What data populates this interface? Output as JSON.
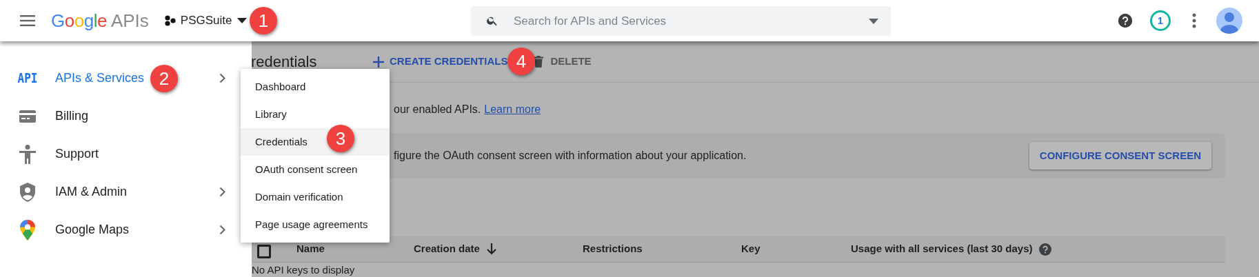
{
  "header": {
    "logo": "Google",
    "logo_suffix": "APIs",
    "project": "PSGSuite",
    "search": {
      "placeholder": "Search for APIs and Services"
    },
    "notification_count": "1"
  },
  "sidebar": {
    "items": [
      {
        "kind": "api",
        "icon_text": "API",
        "label": "APIs & Services",
        "selected": true,
        "has_submenu": true
      },
      {
        "kind": "billing",
        "label": "Billing",
        "selected": false,
        "has_submenu": false
      },
      {
        "kind": "support",
        "label": "Support",
        "selected": false,
        "has_submenu": false
      },
      {
        "kind": "iam",
        "label": "IAM & Admin",
        "selected": false,
        "has_submenu": true
      },
      {
        "kind": "maps",
        "label": "Google Maps",
        "selected": false,
        "has_submenu": true
      }
    ]
  },
  "page": {
    "title": "redentials",
    "toolbar": [
      {
        "kind": "create",
        "label": "CREATE CREDENTIALS"
      },
      {
        "kind": "delete",
        "label": "DELETE"
      }
    ],
    "intro": "our enabled APIs.",
    "intro_link": "Learn more",
    "banner": {
      "text": "figure the OAuth consent screen with information about your application.",
      "button": "CONFIGURE CONSENT SCREEN"
    },
    "table": {
      "columns": [
        {
          "label": "Name",
          "sorted": false,
          "help": false
        },
        {
          "label": "Creation date",
          "sorted": true,
          "help": false
        },
        {
          "label": "Restrictions",
          "sorted": false,
          "help": false
        },
        {
          "label": "Key",
          "sorted": false,
          "help": false
        },
        {
          "label": "Usage with all services (last 30 days)",
          "sorted": false,
          "help": true
        }
      ],
      "checked": false,
      "empty": "No API keys to display"
    }
  },
  "submenu": {
    "items": [
      {
        "label": "Dashboard",
        "selected": false
      },
      {
        "label": "Library",
        "selected": false
      },
      {
        "label": "Credentials",
        "selected": true
      },
      {
        "label": "OAuth consent screen",
        "selected": false
      },
      {
        "label": "Domain verification",
        "selected": false
      },
      {
        "label": "Page usage agreements",
        "selected": false
      }
    ]
  },
  "callouts": [
    {
      "number": "1"
    },
    {
      "number": "2"
    },
    {
      "number": "3"
    },
    {
      "number": "4"
    }
  ]
}
